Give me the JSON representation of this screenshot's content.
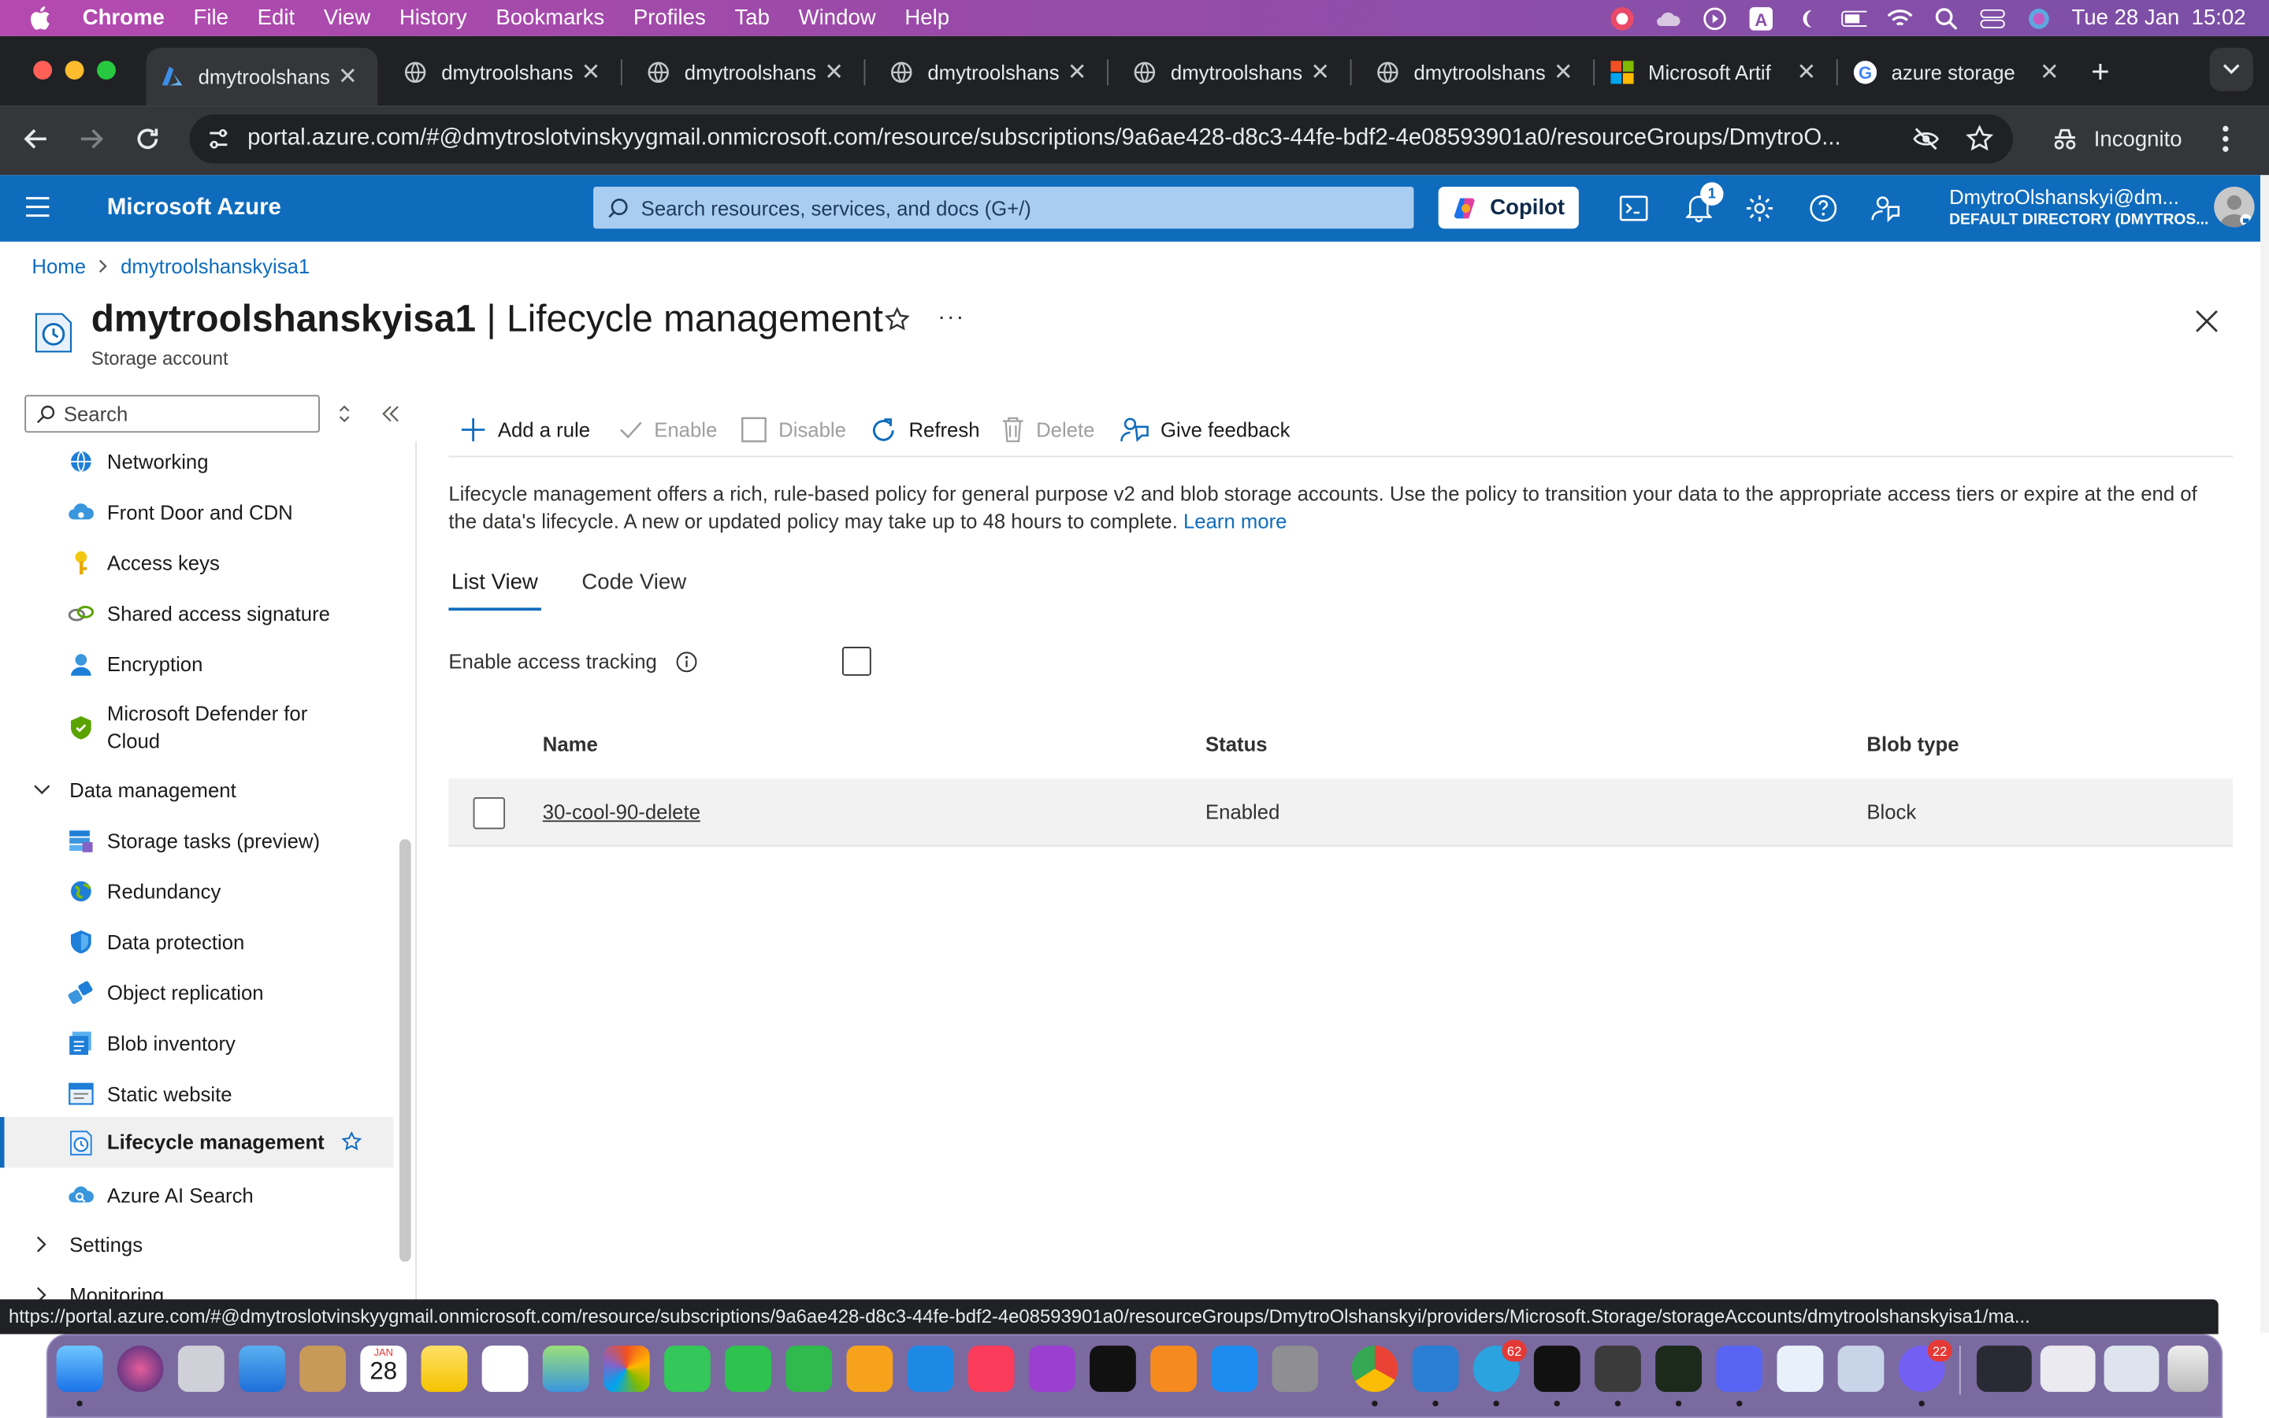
{
  "menubar": {
    "app_name": "Chrome",
    "items": [
      "File",
      "Edit",
      "View",
      "History",
      "Bookmarks",
      "Profiles",
      "Tab",
      "Window",
      "Help"
    ],
    "clock": "Tue 28 Jan  15:02"
  },
  "browser": {
    "tabs": [
      {
        "title": "dmytroolshans",
        "icon": "azure-favicon-icon",
        "active": true
      },
      {
        "title": "dmytroolshans",
        "icon": "globe-icon",
        "active": false
      },
      {
        "title": "dmytroolshans",
        "icon": "globe-icon",
        "active": false
      },
      {
        "title": "dmytroolshans",
        "icon": "globe-icon",
        "active": false
      },
      {
        "title": "dmytroolshans",
        "icon": "globe-icon",
        "active": false
      },
      {
        "title": "dmytroolshans",
        "icon": "globe-icon",
        "active": false
      },
      {
        "title": "Microsoft Artif",
        "icon": "microsoft-favicon-icon",
        "active": false
      },
      {
        "title": "azure storage",
        "icon": "google-favicon-icon",
        "active": false
      }
    ],
    "url": "portal.azure.com/#@dmytroslotvinskyygmail.onmicrosoft.com/resource/subscriptions/9a6ae428-d8c3-44fe-bdf2-4e08593901a0/resourceGroups/DmytroO...",
    "incognito_label": "Incognito",
    "status_url": "https://portal.azure.com/#@dmytroslotvinskyygmail.onmicrosoft.com/resource/subscriptions/9a6ae428-d8c3-44fe-bdf2-4e08593901a0/resourceGroups/DmytroOlshanskyi/providers/Microsoft.Storage/storageAccounts/dmytroolshanskyisa1/ma..."
  },
  "azure": {
    "brand": "Microsoft Azure",
    "search_placeholder": "Search resources, services, and docs (G+/)",
    "copilot_label": "Copilot",
    "notification_count": "1",
    "user_name": "DmytroOlshanskyi@dm...",
    "user_directory": "DEFAULT DIRECTORY (DMYTROS..."
  },
  "breadcrumb": [
    "Home",
    "dmytroolshanskyisa1"
  ],
  "page": {
    "title_resource": "dmytroolshanskyisa1",
    "title_separator": " | ",
    "title_blade": "Lifecycle management",
    "subtitle": "Storage account"
  },
  "sidebar": {
    "search_placeholder": "Search",
    "items": [
      {
        "label": "Networking",
        "icon": "networking-icon"
      },
      {
        "label": "Front Door and CDN",
        "icon": "cloud-cdn-icon"
      },
      {
        "label": "Access keys",
        "icon": "key-icon"
      },
      {
        "label": "Shared access signature",
        "icon": "link-icon"
      },
      {
        "label": "Encryption",
        "icon": "lock-person-icon"
      },
      {
        "label": "Microsoft Defender for Cloud",
        "icon": "defender-shield-icon"
      },
      {
        "label": "Data management",
        "icon": "chevron-down-icon",
        "group": true
      },
      {
        "label": "Storage tasks (preview)",
        "icon": "storage-tasks-icon"
      },
      {
        "label": "Redundancy",
        "icon": "globe-redundancy-icon"
      },
      {
        "label": "Data protection",
        "icon": "shield-icon"
      },
      {
        "label": "Object replication",
        "icon": "replication-icon"
      },
      {
        "label": "Blob inventory",
        "icon": "inventory-icon"
      },
      {
        "label": "Static website",
        "icon": "website-icon"
      },
      {
        "label": "Lifecycle management",
        "icon": "lifecycle-icon",
        "selected": true
      },
      {
        "label": "Azure AI Search",
        "icon": "ai-search-icon"
      },
      {
        "label": "Settings",
        "icon": "chevron-right-icon",
        "group": true
      },
      {
        "label": "Monitoring",
        "icon": "chevron-right-icon",
        "group": true
      }
    ]
  },
  "commands": {
    "add_rule": "Add a rule",
    "enable": "Enable",
    "disable": "Disable",
    "refresh": "Refresh",
    "delete": "Delete",
    "feedback": "Give feedback"
  },
  "description": {
    "text": "Lifecycle management offers a rich, rule-based policy for general purpose v2 and blob storage accounts. Use the policy to transition your data to the appropriate access tiers or expire at the end of the data's lifecycle. A new or updated policy may take up to 48 hours to complete. ",
    "link": "Learn more"
  },
  "view_tabs": {
    "list": "List View",
    "code": "Code View",
    "selected": "List View"
  },
  "access_tracking": {
    "label": "Enable access tracking",
    "checked": false
  },
  "table": {
    "columns": [
      "Name",
      "Status",
      "Blob type"
    ],
    "rows": [
      {
        "name": "30-cool-90-delete",
        "status": "Enabled",
        "blob_type": "Block",
        "checked": false
      }
    ]
  },
  "dock": {
    "calendar_month": "JAN",
    "calendar_day": "28",
    "telegram_badge": "62",
    "viber_badge": "22"
  },
  "colors": {
    "azure_blue": "#0f6cbd",
    "menubar": "#9a4aa8",
    "selected_bg": "#f0f0f0"
  }
}
